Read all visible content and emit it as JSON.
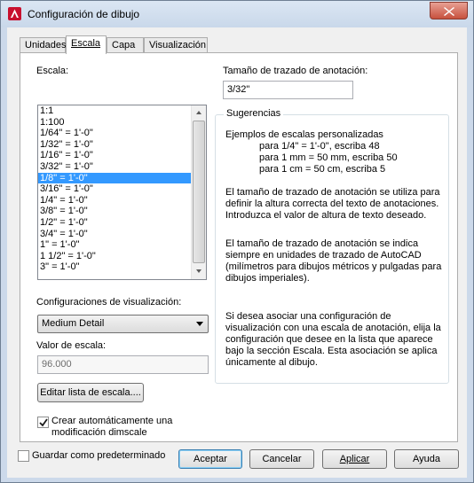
{
  "window": {
    "title": "Configuración de dibujo"
  },
  "tabs": [
    {
      "label": "Unidades"
    },
    {
      "label": "Escala"
    },
    {
      "label": "Capa"
    },
    {
      "label": "Visualización"
    }
  ],
  "scale": {
    "label": "Escala:",
    "items": [
      "1:1",
      "1:100",
      "1/64\" = 1'-0\"",
      "1/32\" = 1'-0\"",
      "1/16\" = 1'-0\"",
      "3/32\" = 1'-0\"",
      "1/8\" = 1'-0\"",
      "3/16\" = 1'-0\"",
      "1/4\" = 1'-0\"",
      "3/8\" = 1'-0\"",
      "1/2\" = 1'-0\"",
      "3/4\" = 1'-0\"",
      "1\" = 1'-0\"",
      "1 1/2\" = 1'-0\"",
      "3\" = 1'-0\""
    ],
    "selected_index": 6
  },
  "display_config": {
    "label": "Configuraciones de visualización:",
    "value": "Medium Detail"
  },
  "scale_value": {
    "label": "Valor de escala:",
    "value": "96.000"
  },
  "edit_scale_list_button": "Editar lista de escala....",
  "auto_dimscale": {
    "checked": true,
    "line1": "Crear automáticamente una",
    "line2": "modificación dimscale"
  },
  "annotation": {
    "label": "Tamaño de trazado de anotación:",
    "value": "3/32\""
  },
  "hints": {
    "title": "Sugerencias",
    "examples_title": "Ejemplos de escalas personalizadas",
    "examples": [
      "para 1/4\" = 1'-0\", escriba 48",
      "para 1 mm = 50 mm, escriba 50",
      "para 1 cm = 50 cm, escriba 5"
    ],
    "para1": [
      "El tamaño de trazado de anotación se utiliza para",
      "definir la altura correcta del texto de anotaciones.",
      "Introduzca el valor de altura de texto deseado."
    ],
    "para2": [
      "El tamaño de trazado de anotación se indica",
      "siempre en unidades de trazado de AutoCAD",
      "(milímetros para dibujos métricos y pulgadas para",
      "dibujos imperiales)."
    ],
    "para3": [
      "Si desea asociar una configuración de",
      "visualización con una escala de anotación, elija la",
      "configuración que desee en la lista que aparece",
      "bajo la sección Escala. Esta asociación se aplica",
      "únicamente al dibujo."
    ]
  },
  "save_default": {
    "checked": false,
    "label": "Guardar como predeterminado"
  },
  "buttons": {
    "ok": "Aceptar",
    "cancel": "Cancelar",
    "apply": "Aplicar",
    "help": "Ayuda"
  }
}
